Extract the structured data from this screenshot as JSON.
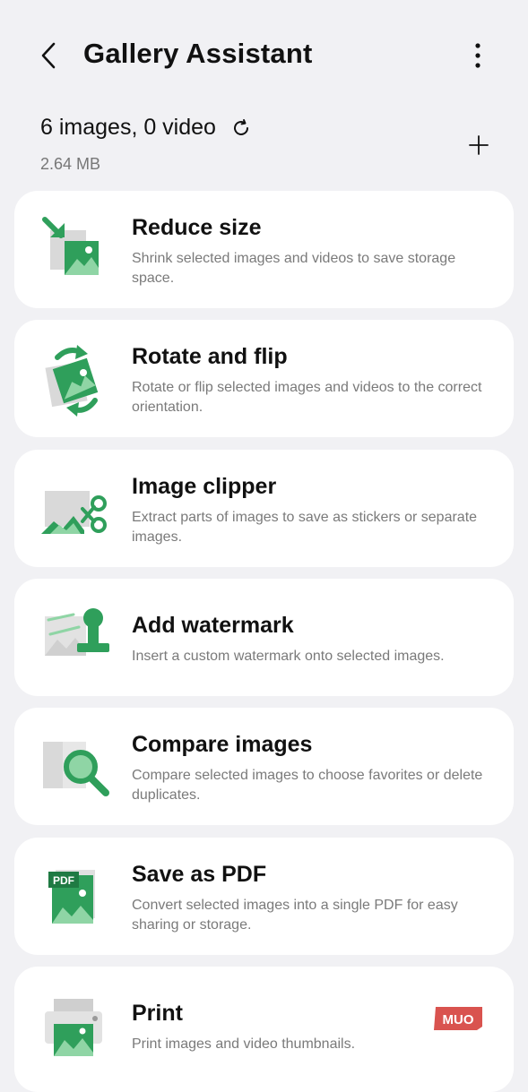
{
  "header": {
    "title": "Gallery Assistant"
  },
  "summary": {
    "counts": "6 images, 0 video",
    "size": "2.64 MB"
  },
  "tools": [
    {
      "title": "Reduce size",
      "desc": "Shrink selected images and videos to save storage space.",
      "icon": "reduce-size-icon"
    },
    {
      "title": "Rotate and flip",
      "desc": "Rotate or flip selected images and videos to the correct orientation.",
      "icon": "rotate-flip-icon"
    },
    {
      "title": "Image clipper",
      "desc": "Extract parts of images to save as stickers or separate images.",
      "icon": "image-clipper-icon"
    },
    {
      "title": "Add watermark",
      "desc": "Insert a custom watermark onto selected images.",
      "icon": "watermark-icon"
    },
    {
      "title": "Compare images",
      "desc": "Compare selected images to choose favorites or delete duplicates.",
      "icon": "compare-images-icon"
    },
    {
      "title": "Save as PDF",
      "desc": "Convert selected images into a single PDF for easy sharing or storage.",
      "icon": "pdf-icon",
      "icon_text": "PDF"
    },
    {
      "title": "Print",
      "desc": "Print images and video thumbnails.",
      "icon": "printer-icon"
    }
  ],
  "watermark_badge": "MUO",
  "colors": {
    "background": "#f1f1f4",
    "card": "#ffffff",
    "accent_green": "#2f9f5b",
    "badge_red": "#d9534f"
  }
}
